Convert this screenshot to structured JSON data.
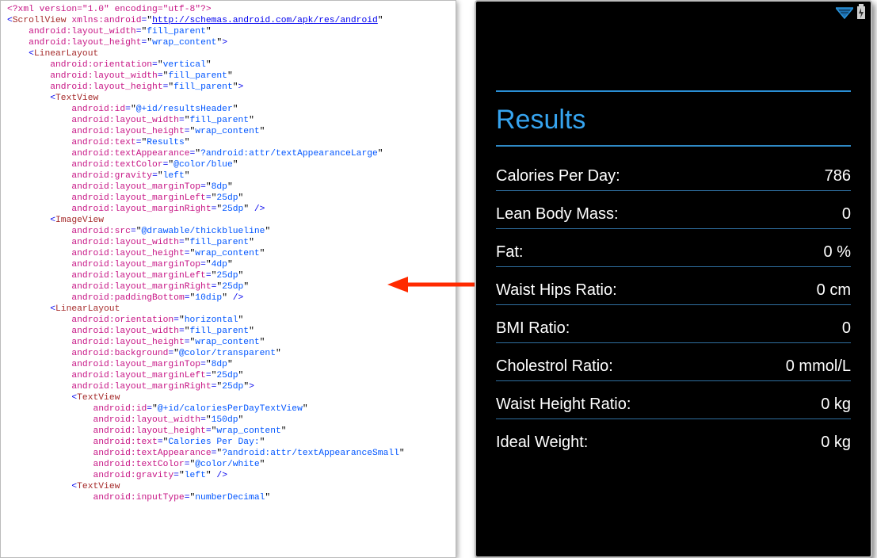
{
  "xml": {
    "decl": "<?xml version=\"1.0\" encoding=\"utf-8\"?>",
    "scrollview_open_tag": "ScrollView",
    "xmlns_attr": "xmlns:android",
    "xmlns_val": "http://schemas.android.com/apk/res/android",
    "sv_attrs": [
      {
        "name": "android:layout_width",
        "value": "fill_parent"
      },
      {
        "name": "android:layout_height",
        "value": "wrap_content"
      }
    ],
    "ll_tag": "LinearLayout",
    "ll_attrs": [
      {
        "name": "android:orientation",
        "value": "vertical"
      },
      {
        "name": "android:layout_width",
        "value": "fill_parent"
      },
      {
        "name": "android:layout_height",
        "value": "fill_parent"
      }
    ],
    "tv_header_tag": "TextView",
    "tv_header_attrs": [
      {
        "name": "android:id",
        "value": "@+id/resultsHeader"
      },
      {
        "name": "android:layout_width",
        "value": "fill_parent"
      },
      {
        "name": "android:layout_height",
        "value": "wrap_content"
      },
      {
        "name": "android:text",
        "value": "Results"
      },
      {
        "name": "android:textAppearance",
        "value": "?android:attr/textAppearanceLarge"
      },
      {
        "name": "android:textColor",
        "value": "@color/blue"
      },
      {
        "name": "android:gravity",
        "value": "left"
      },
      {
        "name": "android:layout_marginTop",
        "value": "8dp"
      },
      {
        "name": "android:layout_marginLeft",
        "value": "25dp"
      },
      {
        "name": "android:layout_marginRight",
        "value": "25dp"
      }
    ],
    "iv_tag": "ImageView",
    "iv_attrs": [
      {
        "name": "android:src",
        "value": "@drawable/thickblueline"
      },
      {
        "name": "android:layout_width",
        "value": "fill_parent"
      },
      {
        "name": "android:layout_height",
        "value": "wrap_content"
      },
      {
        "name": "android:layout_marginTop",
        "value": "4dp"
      },
      {
        "name": "android:layout_marginLeft",
        "value": "25dp"
      },
      {
        "name": "android:layout_marginRight",
        "value": "25dp"
      },
      {
        "name": "android:paddingBottom",
        "value": "10dip"
      }
    ],
    "ll2_tag": "LinearLayout",
    "ll2_attrs": [
      {
        "name": "android:orientation",
        "value": "horizontal"
      },
      {
        "name": "android:layout_width",
        "value": "fill_parent"
      },
      {
        "name": "android:layout_height",
        "value": "wrap_content"
      },
      {
        "name": "android:background",
        "value": "@color/transparent"
      },
      {
        "name": "android:layout_marginTop",
        "value": "8dp"
      },
      {
        "name": "android:layout_marginLeft",
        "value": "25dp"
      },
      {
        "name": "android:layout_marginRight",
        "value": "25dp"
      }
    ],
    "tv_cal_tag": "TextView",
    "tv_cal_attrs": [
      {
        "name": "android:id",
        "value": "@+id/caloriesPerDayTextView"
      },
      {
        "name": "android:layout_width",
        "value": "150dp"
      },
      {
        "name": "android:layout_height",
        "value": "wrap_content"
      },
      {
        "name": "android:text",
        "value": "Calories Per Day:"
      },
      {
        "name": "android:textAppearance",
        "value": "?android:attr/textAppearanceSmall"
      },
      {
        "name": "android:textColor",
        "value": "@color/white"
      },
      {
        "name": "android:gravity",
        "value": "left"
      }
    ],
    "tv_tail_tag": "TextView",
    "tv_tail_attrs": [
      {
        "name": "android:inputType",
        "value": "numberDecimal"
      }
    ]
  },
  "results": {
    "header": "Results",
    "metrics": [
      {
        "label": "Calories Per Day:",
        "value": "786"
      },
      {
        "label": "Lean Body Mass:",
        "value": "0"
      },
      {
        "label": "Fat:",
        "value": "0 %"
      },
      {
        "label": "Waist Hips Ratio:",
        "value": "0 cm"
      },
      {
        "label": "BMI Ratio:",
        "value": "0"
      },
      {
        "label": "Cholestrol Ratio:",
        "value": "0 mmol/L"
      },
      {
        "label": "Waist Height Ratio:",
        "value": "0 kg"
      },
      {
        "label": "Ideal Weight:",
        "value": "0 kg"
      }
    ]
  }
}
